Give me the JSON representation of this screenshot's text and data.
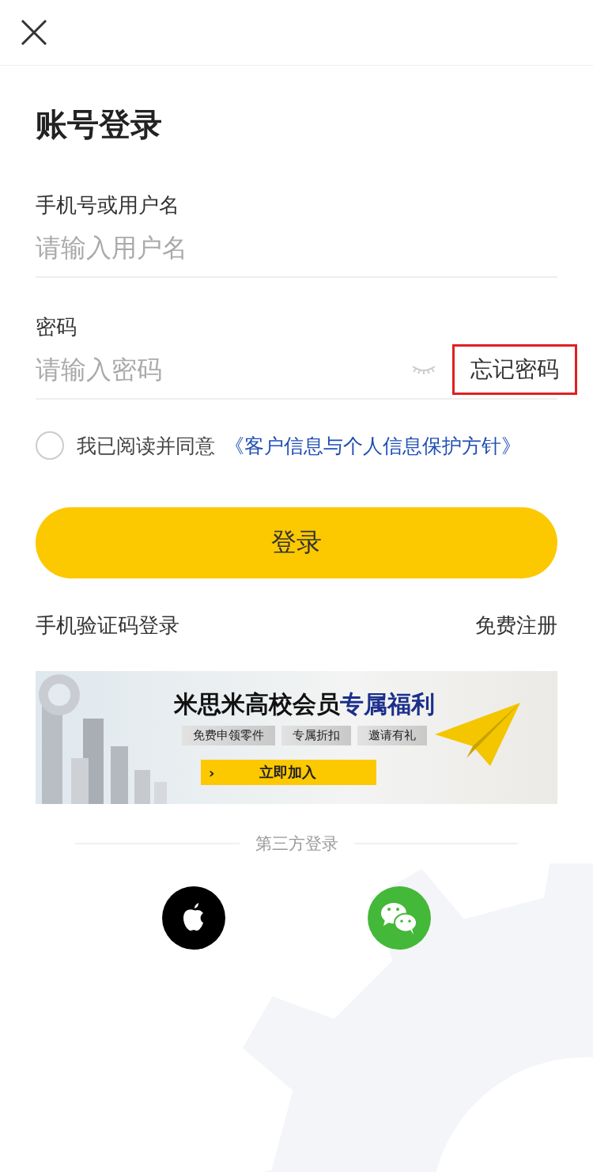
{
  "title": "账号登录",
  "fields": [
    {
      "label": "手机号或用户名",
      "placeholder": "请输入用户名",
      "kind": "text"
    },
    {
      "label": "密码",
      "placeholder": "请输入密码",
      "kind": "password",
      "password_visible": false,
      "forgot_link": "忘记密码",
      "forgot_highlighted": true
    }
  ],
  "agreement": {
    "checked": false,
    "text": "我已阅读并同意",
    "link": "《客户信息与个人信息保护方针》"
  },
  "login_button": "登录",
  "links": [
    "手机验证码登录",
    "免费注册"
  ],
  "banner": {
    "headline": "米思米高校会员",
    "headline_highlight": "专属福利",
    "tags": [
      "免费申领零件",
      "专属折扣",
      "邀请有礼"
    ],
    "cta_icon": "›",
    "cta": "立即加入"
  },
  "third_party": {
    "label": "第三方登录",
    "providers": [
      {
        "kind": "apple"
      },
      {
        "kind": "wechat"
      }
    ]
  }
}
